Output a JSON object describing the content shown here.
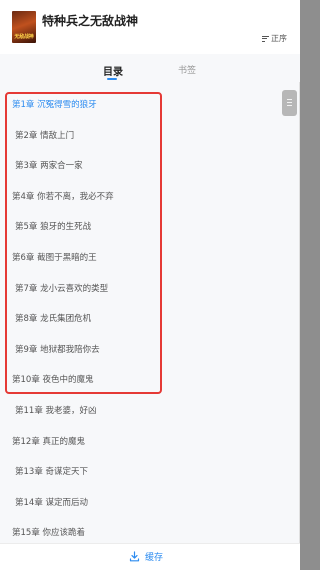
{
  "header": {
    "book_title": "特种兵之无敌战神",
    "cover_text": "无敌战神",
    "sort_label": "正序"
  },
  "tabs": [
    {
      "label": "目录",
      "active": true
    },
    {
      "label": "书签",
      "active": false
    }
  ],
  "chapters": [
    {
      "label": "第1章 沉冤得雪的狼牙",
      "current": true
    },
    {
      "label": "第2章 情敌上门",
      "current": false
    },
    {
      "label": "第3章 两家合一家",
      "current": false
    },
    {
      "label": "第4章 你若不离，我必不弃",
      "current": false
    },
    {
      "label": "第5章 狼牙的生死战",
      "current": false
    },
    {
      "label": "第6章 截图于黑暗的王",
      "current": false
    },
    {
      "label": "第7章 龙小云喜欢的类型",
      "current": false
    },
    {
      "label": "第8章 龙氏集团危机",
      "current": false
    },
    {
      "label": "第9章 地狱都我陪你去",
      "current": false
    },
    {
      "label": "第10章 夜色中的魔鬼",
      "current": false
    },
    {
      "label": "第11章 我老婆，好凶",
      "current": false
    },
    {
      "label": "第12章 真正的魔鬼",
      "current": false
    },
    {
      "label": "第13章 奇谋定天下",
      "current": false
    },
    {
      "label": "第14章 谋定而后动",
      "current": false
    },
    {
      "label": "第15章 你应该跪着",
      "current": false
    }
  ],
  "footer": {
    "cache_label": "缓存",
    "cache_icon": "download-icon"
  },
  "colors": {
    "accent": "#2d8cf0",
    "highlight": "#e53935"
  }
}
